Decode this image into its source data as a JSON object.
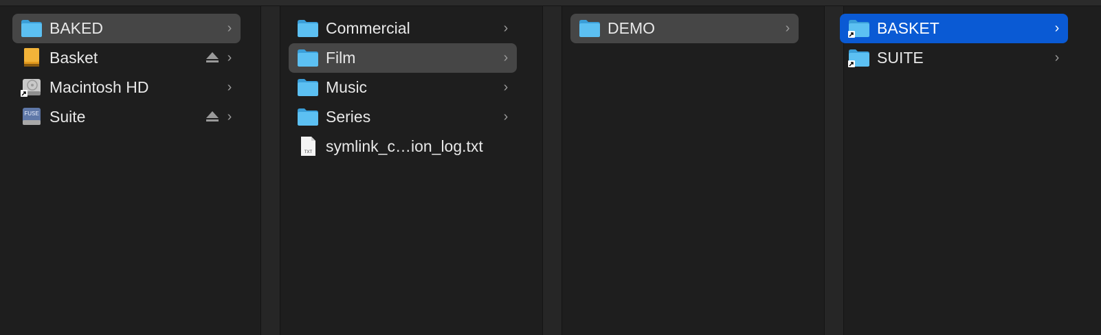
{
  "columns": [
    {
      "items": [
        {
          "label": "BAKED",
          "icon": "folder-icon",
          "state": "highlighted",
          "chevron": true,
          "eject": false
        },
        {
          "label": "Basket",
          "icon": "external-drive-icon",
          "state": "normal",
          "chevron": true,
          "eject": true
        },
        {
          "label": "Macintosh HD",
          "icon": "hard-drive-alias-icon",
          "state": "normal",
          "chevron": true,
          "eject": false
        },
        {
          "label": "Suite",
          "icon": "fuse-drive-icon",
          "state": "normal",
          "chevron": true,
          "eject": true,
          "badge": "FUSE"
        }
      ]
    },
    {
      "items": [
        {
          "label": "Commercial",
          "icon": "folder-icon",
          "state": "normal",
          "chevron": true
        },
        {
          "label": "Film",
          "icon": "folder-icon",
          "state": "highlighted",
          "chevron": true
        },
        {
          "label": "Music",
          "icon": "folder-icon",
          "state": "normal",
          "chevron": true
        },
        {
          "label": "Series",
          "icon": "folder-icon",
          "state": "normal",
          "chevron": true
        },
        {
          "label": "symlink_c…ion_log.txt",
          "icon": "text-file-icon",
          "state": "normal",
          "chevron": false,
          "badge": "TXT"
        }
      ]
    },
    {
      "items": [
        {
          "label": "DEMO",
          "icon": "folder-icon",
          "state": "highlighted",
          "chevron": true
        }
      ]
    },
    {
      "items": [
        {
          "label": "BASKET",
          "icon": "folder-alias-icon",
          "state": "selected",
          "chevron": true
        },
        {
          "label": "SUITE",
          "icon": "folder-alias-icon",
          "state": "normal",
          "chevron": true
        }
      ]
    }
  ],
  "glyphs": {
    "chevron": "›"
  },
  "colors": {
    "background": "#1e1e1e",
    "highlight": "#464646",
    "selection": "#0a5ad4",
    "folder": "#4fb7ee"
  }
}
